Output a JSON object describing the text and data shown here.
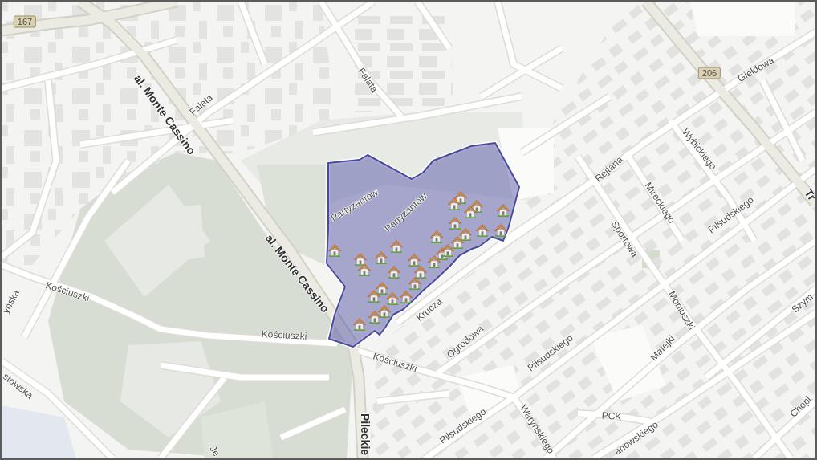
{
  "map": {
    "road_numbers": [
      {
        "text": "167"
      },
      {
        "text": "206"
      }
    ],
    "street_labels": [
      {
        "text": "Falata",
        "kind": "local"
      },
      {
        "text": "Giełdowa",
        "kind": "local"
      },
      {
        "text": "al. Monte Cassino",
        "kind": "main"
      },
      {
        "text": "Falata",
        "kind": "local"
      },
      {
        "text": "Wybickiego",
        "kind": "local"
      },
      {
        "text": "Rejtana",
        "kind": "local"
      },
      {
        "text": "Tr",
        "kind": "main"
      },
      {
        "text": "Mireckiego",
        "kind": "local"
      },
      {
        "text": "Piłsudskiego",
        "kind": "local"
      },
      {
        "text": "Partyzantów",
        "kind": "local"
      },
      {
        "text": "Sportowa",
        "kind": "local"
      },
      {
        "text": "al. Monte Cassino",
        "kind": "main"
      },
      {
        "text": "Kościuszki",
        "kind": "local"
      },
      {
        "text": "yńska",
        "kind": "local"
      },
      {
        "text": "Partyzantów",
        "kind": "local"
      },
      {
        "text": "Krucza",
        "kind": "local"
      },
      {
        "text": "Moniuszki",
        "kind": "local"
      },
      {
        "text": "Szym",
        "kind": "local"
      },
      {
        "text": "Kościuszki",
        "kind": "local"
      },
      {
        "text": "Ogrodowa",
        "kind": "local"
      },
      {
        "text": "Piłsudskiego",
        "kind": "local"
      },
      {
        "text": "Matejki",
        "kind": "local"
      },
      {
        "text": "Kościuszki",
        "kind": "local"
      },
      {
        "text": "stowska",
        "kind": "local"
      },
      {
        "text": "Chopi",
        "kind": "local"
      },
      {
        "text": "PCK",
        "kind": "local"
      },
      {
        "text": "Waryńskiego",
        "kind": "local"
      },
      {
        "text": "Piłsudskiego",
        "kind": "local"
      },
      {
        "text": "anowskiego",
        "kind": "local"
      },
      {
        "text": "Pileckie",
        "kind": "main"
      },
      {
        "text": "Je",
        "kind": "local"
      }
    ]
  }
}
